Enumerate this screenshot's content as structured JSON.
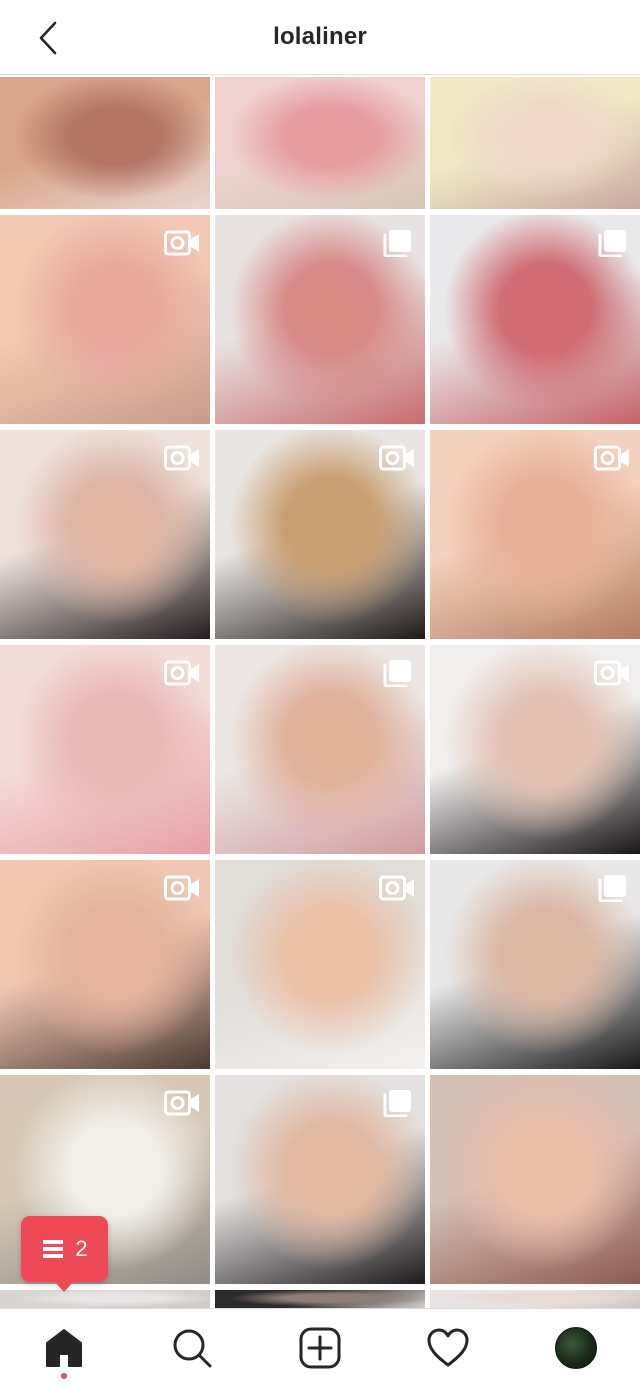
{
  "header": {
    "username": "lolaliner",
    "back_icon": "chevron-left-icon"
  },
  "grid": {
    "tiles": [
      {
        "type": "photo",
        "c1": "#d9a58c",
        "c2": "#b47568",
        "c3": "#e9d6cf"
      },
      {
        "type": "photo",
        "c1": "#efd2cf",
        "c2": "#e79c9e",
        "c3": "#d7c6b8"
      },
      {
        "type": "photo",
        "c1": "#f1e9c6",
        "c2": "#eed7c6",
        "c3": "#c9a8a1"
      },
      {
        "type": "video",
        "c1": "#f2c9b3",
        "c2": "#e9a9a1",
        "c3": "#c99b8a"
      },
      {
        "type": "carousel",
        "c1": "#e8e3e2",
        "c2": "#d88a86",
        "c3": "#c86b6d"
      },
      {
        "type": "carousel",
        "c1": "#e9e8ea",
        "c2": "#cf6d72",
        "c3": "#c56367"
      },
      {
        "type": "video",
        "c1": "#efe2dd",
        "c2": "#dcb6a3",
        "c3": "#241d1e"
      },
      {
        "type": "video",
        "c1": "#e9e5e2",
        "c2": "#c89f72",
        "c3": "#201a19"
      },
      {
        "type": "video",
        "c1": "#f3d2bd",
        "c2": "#e8b09b",
        "c3": "#b57c62"
      },
      {
        "type": "video",
        "c1": "#f2dcd8",
        "c2": "#e9b9b6",
        "c3": "#e89fa6"
      },
      {
        "type": "carousel",
        "c1": "#ece7e4",
        "c2": "#e0b29b",
        "c3": "#cf9da1"
      },
      {
        "type": "video",
        "c1": "#f1eeee",
        "c2": "#e2c3b2",
        "c3": "#1b1718"
      },
      {
        "type": "video",
        "c1": "#eec8b3",
        "c2": "#e4b29e",
        "c3": "#4c3a32"
      },
      {
        "type": "video",
        "c1": "#e0dcd8",
        "c2": "#e9c2a8",
        "c3": "#f3f0ee"
      },
      {
        "type": "carousel",
        "c1": "#e9e8e8",
        "c2": "#d9b8a3",
        "c3": "#1b1a1c"
      },
      {
        "type": "video",
        "c1": "#d7c8b5",
        "c2": "#f1eee9",
        "c3": "#8f8b86"
      },
      {
        "type": "carousel",
        "c1": "#e3e0df",
        "c2": "#dfb9a1",
        "c3": "#1d1b1d"
      },
      {
        "type": "photo",
        "c1": "#d6bfb3",
        "c2": "#e8c0aa",
        "c3": "#8a5c52"
      },
      {
        "type": "carousel",
        "c1": "#d8d4d2",
        "c2": "#e8e5e4",
        "c3": "#cfcac8"
      },
      {
        "type": "carousel",
        "c1": "#2c2a2b",
        "c2": "#8d7f78",
        "c3": "#d6d0cd"
      },
      {
        "type": "photo",
        "c1": "#e8e4e4",
        "c2": "#e9d9d4",
        "c3": "#d1c6c2"
      }
    ]
  },
  "notification": {
    "count": "2",
    "icon": "activity-feed-icon"
  },
  "bottom_nav": {
    "items": [
      "home-icon",
      "search-icon",
      "new-post-icon",
      "heart-icon",
      "profile-avatar"
    ]
  },
  "colors": {
    "badge": "#ed4956",
    "text": "#262626",
    "border": "#dbdbdb"
  }
}
